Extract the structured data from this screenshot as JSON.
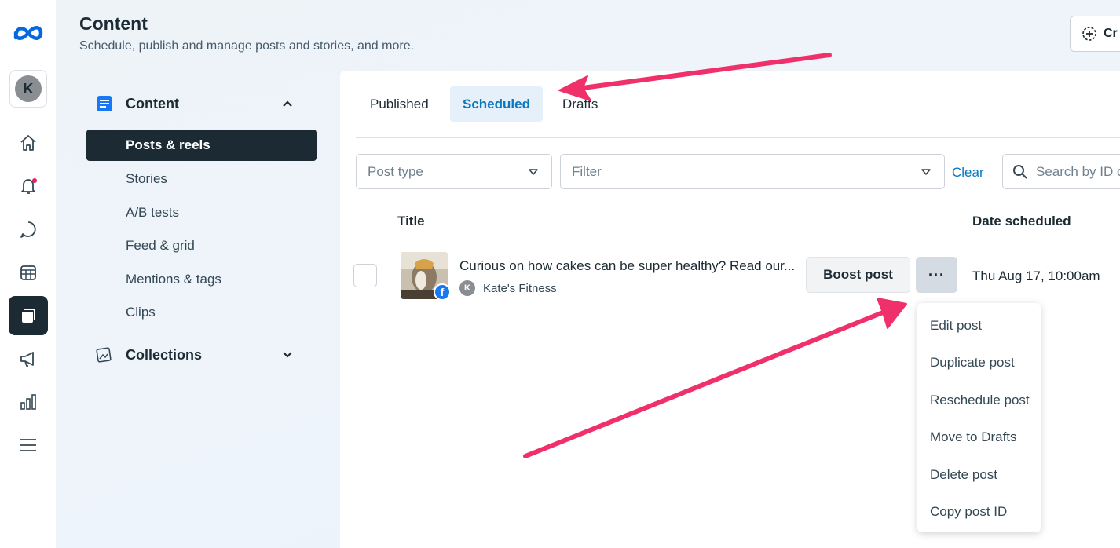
{
  "header": {
    "title": "Content",
    "subtitle": "Schedule, publish and manage posts and stories, and more.",
    "create_label": "Cr"
  },
  "rail": {
    "avatar_letter": "K",
    "icons": [
      "home-icon",
      "notifications-icon",
      "chat-icon",
      "calendar-icon",
      "content-icon",
      "ads-icon",
      "insights-icon",
      "menu-icon"
    ],
    "notification_dot_color": "#e0245e"
  },
  "sidebar": {
    "content_section": "Content",
    "items": [
      {
        "label": "Posts & reels",
        "active": true
      },
      {
        "label": "Stories"
      },
      {
        "label": "A/B tests"
      },
      {
        "label": "Feed & grid"
      },
      {
        "label": "Mentions & tags"
      },
      {
        "label": "Clips"
      }
    ],
    "collections_section": "Collections"
  },
  "tabs": [
    {
      "label": "Published"
    },
    {
      "label": "Scheduled",
      "active": true
    },
    {
      "label": "Drafts"
    }
  ],
  "filters": {
    "post_type_placeholder": "Post type",
    "filter_placeholder": "Filter",
    "clear_label": "Clear",
    "search_placeholder": "Search by ID or"
  },
  "table": {
    "columns": [
      "Title",
      "Date scheduled"
    ],
    "rows": [
      {
        "text": "Curious on how cakes can be super healthy? Read our...",
        "author_initial": "K",
        "author": "Kate's Fitness",
        "boost_label": "Boost post",
        "more_label": "···",
        "date": "Thu Aug 17, 10:00am"
      }
    ]
  },
  "menu": {
    "items": [
      "Edit post",
      "Duplicate post",
      "Reschedule post",
      "Move to Drafts",
      "Delete post",
      "Copy post ID"
    ]
  },
  "colors": {
    "accent": "#0a78be",
    "annotation_arrow": "#f0306a",
    "dark": "#1c2b33"
  }
}
